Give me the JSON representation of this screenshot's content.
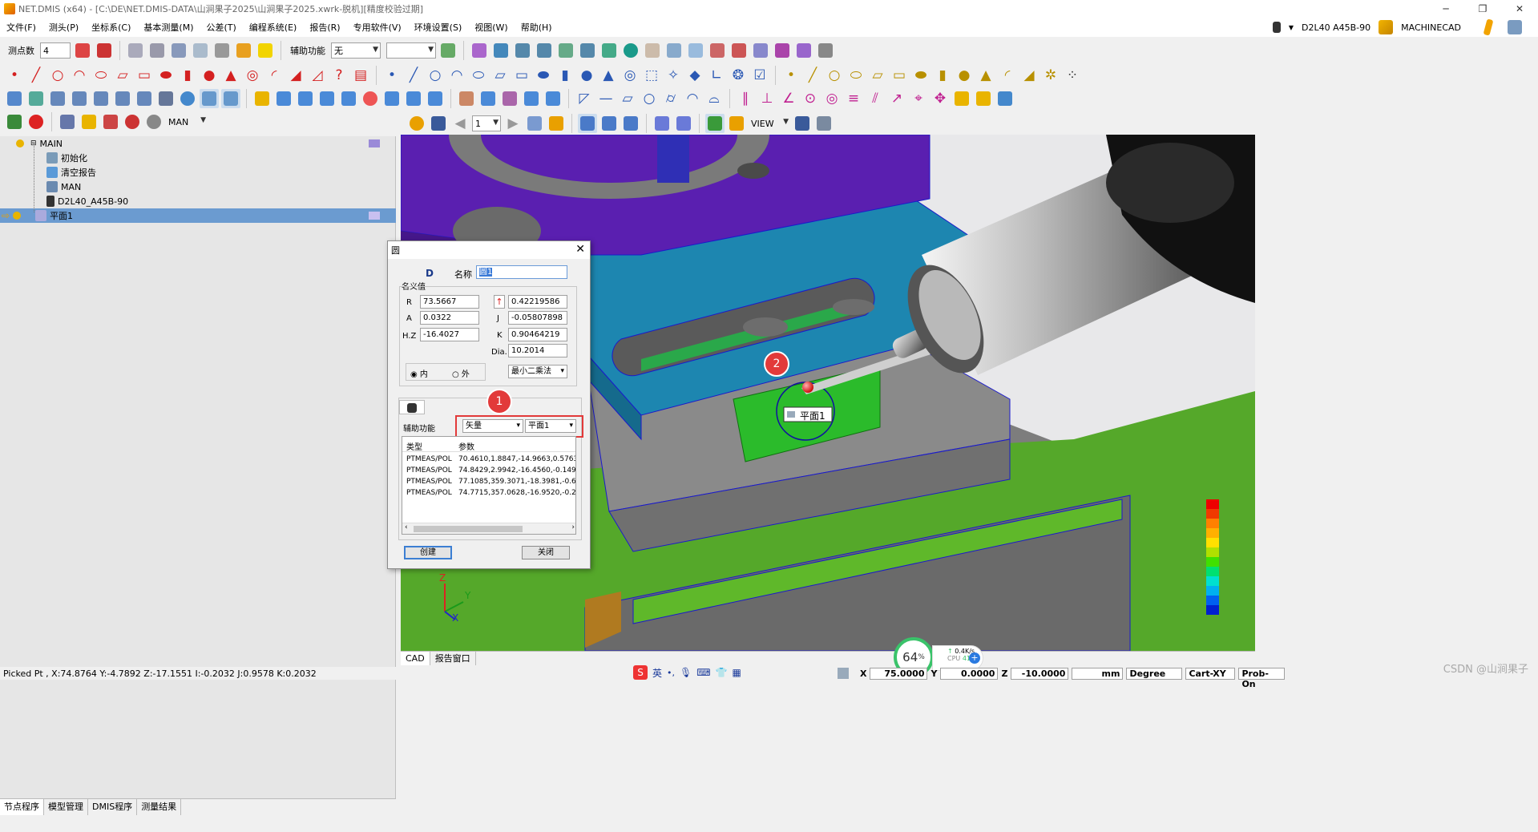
{
  "window": {
    "title": "NET.DMIS (x64) - [C:\\DE\\NET.DMIS-DATA\\山涧果子2025\\山涧果子2025.xwrk-脱机][精度校验过期]",
    "controls": [
      "─",
      "❐",
      "✕"
    ]
  },
  "menu": {
    "items": [
      "文件(F)",
      "测头(P)",
      "坐标系(C)",
      "基本测量(M)",
      "公差(T)",
      "编程系统(E)",
      "报告(R)",
      "专用软件(V)",
      "环境设置(S)",
      "视图(W)",
      "帮助(H)"
    ],
    "probe": "D2L40  A45B-90",
    "machine": "MACHINECAD"
  },
  "toolbar": {
    "points_label": "测点数",
    "points_value": "4",
    "aux_label": "辅助功能",
    "aux_value": "无",
    "mode_value": "MAN",
    "view_value": "VIEW",
    "page_value": "1"
  },
  "tree": {
    "rows": [
      {
        "label": "MAIN",
        "selected": false
      },
      {
        "label": "初始化",
        "selected": false
      },
      {
        "label": "清空报告",
        "selected": false
      },
      {
        "label": "MAN",
        "selected": false
      },
      {
        "label": "D2L40_A45B-90",
        "selected": false
      },
      {
        "label": "平面1",
        "selected": true
      }
    ],
    "tabs": [
      "节点程序",
      "模型管理",
      "DMIS程序",
      "测量结果"
    ]
  },
  "dialog": {
    "title": "圆",
    "name_label": "名称",
    "name_value": "圆1",
    "nominal_label": "名义值",
    "r_label": "R",
    "r_value": "73.5667",
    "a_label": "A",
    "a_value": "0.0322",
    "hz_label": "H.Z",
    "hz_value": "-16.4027",
    "i_value": "0.42219586",
    "j_label": "J",
    "j_value": "-0.05807898",
    "k_label": "K",
    "k_value": "0.90464219",
    "dia_label": "Dia.",
    "dia_value": "10.2014",
    "inner_label": "内",
    "outer_label": "外",
    "fit_method": "最小二乘法",
    "aux_label": "辅助功能",
    "aux_type": "矢量",
    "aux_ref": "平面1",
    "table_headers": [
      "类型",
      "参数"
    ],
    "rows": [
      {
        "type": "PTMEAS/POL",
        "params": "70.4610,1.8847,-14.9663,0.576352"
      },
      {
        "type": "PTMEAS/POL",
        "params": "74.8429,2.9942,-16.4560,-0.14959"
      },
      {
        "type": "PTMEAS/POL",
        "params": "77.1085,359.3071,-18.3981,-0.6876"
      },
      {
        "type": "PTMEAS/POL",
        "params": "74.7715,357.0628,-16.9520,-0.2031"
      }
    ],
    "create_label": "创建",
    "close_label": "关闭"
  },
  "annotations": {
    "badge1": "1",
    "badge2": "2",
    "plane_tag": "平面1"
  },
  "viewport": {
    "tabs": [
      "CAD",
      "报告窗口"
    ],
    "axis_x": "X",
    "axis_y": "Y",
    "axis_z": "Z"
  },
  "status": {
    "picked": "Picked Pt , X:74.8764 Y:-4.7892 Z:-17.1551  I:-0.2032  J:0.9578  K:0.2032",
    "x_label": "X",
    "x_value": "75.0000",
    "y_label": "Y",
    "y_value": "0.0000",
    "z_label": "Z",
    "z_value": "-10.0000",
    "unit": "mm",
    "angle": "Degree",
    "coord": "Cart-XY",
    "probe_mode": "Prob-On",
    "ime": "英"
  },
  "cpu": {
    "percent": "64",
    "percent_sign": "%",
    "net": "0.4K/s",
    "cpu_label": "CPU",
    "temp": "41℃"
  },
  "watermark": "CSDN @山涧果子",
  "colors": {
    "purple": "#5a1fb0",
    "teal": "#1888b3",
    "gray": "#8b8b8b",
    "green": "#3cc41a",
    "accent_red": "#e23a3a",
    "selection": "#6b9bd0"
  }
}
